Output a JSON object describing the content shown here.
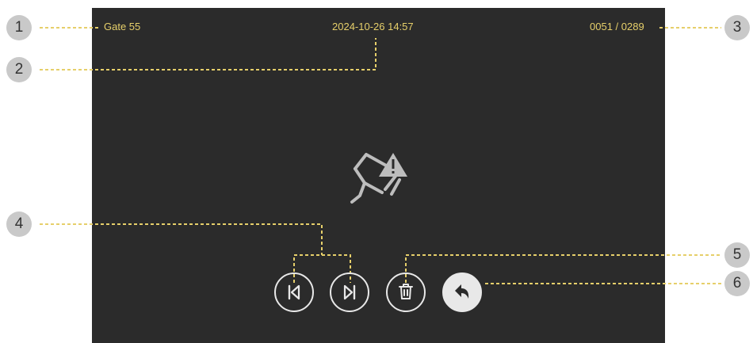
{
  "device_screen": {
    "camera_name": "Gate 55",
    "datetime": "2024-10-26  14:57",
    "record_counter": "0051 / 0289",
    "center_icon": "camera-no-signal-warning-icon"
  },
  "controls": {
    "prev_icon": "skip-previous-icon",
    "next_icon": "skip-next-icon",
    "delete_icon": "trash-icon",
    "back_icon": "back-arrow-icon"
  },
  "callouts": [
    "1",
    "2",
    "3",
    "4",
    "5",
    "6"
  ],
  "colors": {
    "screen_bg": "#2b2b2b",
    "overlay_text": "#e6cf6a",
    "leader_line": "#e6cf6a",
    "callout_bg": "#c9c9c9",
    "icon_stroke": "#e8e8e8"
  }
}
